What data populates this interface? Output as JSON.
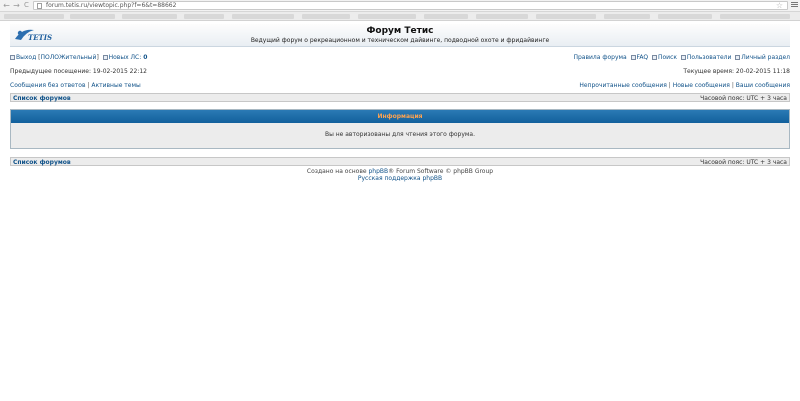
{
  "browser": {
    "back_glyph": "←",
    "forward_glyph": "→",
    "reload_glyph": "C",
    "url": "forum.tetis.ru/viewtopic.php?f=6&t=88662",
    "star_glyph": "☆"
  },
  "header": {
    "logo_text": "TETIS",
    "title": "Форум Тетис",
    "description": "Ведущий форум о рекреационном и техническом дайвинге, подводной охоте и фридайвинге"
  },
  "topnav": {
    "logout": "Выход",
    "username": "ПОЛОЖительный",
    "new_pm_label": "Новых ЛС:",
    "new_pm_count": "0",
    "rules": "Правила форума",
    "faq": "FAQ",
    "search": "Поиск",
    "users": "Пользователи",
    "personal": "Личный раздел"
  },
  "visits": {
    "last_visit": "Предыдущее посещение: 19-02-2015 22:12",
    "current_time": "Текущее время: 20-02-2015 11:18"
  },
  "links": {
    "unanswered": "Сообщения без ответов",
    "active": "Активные темы",
    "unread": "Непрочитанные сообщения",
    "new_posts": "Новые сообщения",
    "your_posts": "Ваши сообщения"
  },
  "crumb": {
    "forum_index": "Список форумов",
    "timezone": "Часовой пояс: UTC + 3 часа"
  },
  "info": {
    "heading": "Информация",
    "message": "Вы не авторизованы для чтения этого форума."
  },
  "footer": {
    "created_prefix": "Создано на основе",
    "phpbb": "phpBB",
    "created_suffix": "® Forum Software © phpBB Group",
    "russian_support": "Русская поддержка phpBB"
  },
  "colors": {
    "link": "#105289",
    "info_header": "#12609c",
    "info_title": "#ffa34f"
  }
}
